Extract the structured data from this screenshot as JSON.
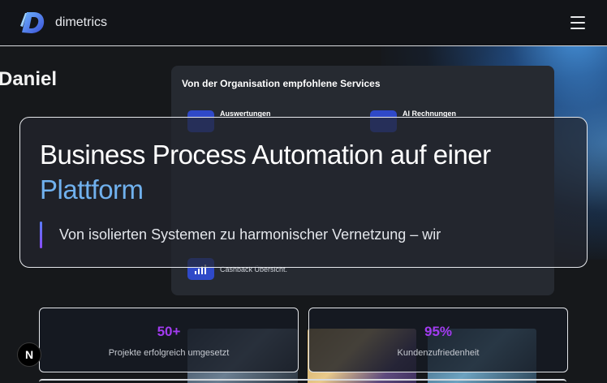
{
  "header": {
    "brand": "dimetrics",
    "logo_icon": "dimetrics-logo-icon",
    "menu_icon": "hamburger-menu-icon"
  },
  "background": {
    "name": "Daniel",
    "dashboard": {
      "title": "Von der Organisation empfohlene Services",
      "services": [
        {
          "label": "Auswertungen",
          "icon": "chart-icon"
        },
        {
          "label": "AI Rechnungen",
          "icon": "document-icon"
        },
        {
          "label": "Cashback Übersicht.",
          "icon": "bar-chart-icon"
        }
      ]
    }
  },
  "hero": {
    "title": "Business Process Automation auf einer",
    "title_accent": "Plattform",
    "subtitle": "Von isolierten Systemen zu harmonischer Vernetzung – wir"
  },
  "stats": [
    {
      "value": "50+",
      "label": "Projekte erfolgreich umgesetzt"
    },
    {
      "value": "95%",
      "label": "Kundenzufriedenheit"
    }
  ],
  "badge": {
    "label": "N",
    "icon": "nextjs-badge-icon"
  },
  "colors": {
    "accent_blue": "#70b1ee",
    "stat_purple": "#a23bf0",
    "background": "#16181b",
    "service_icon": "#2f49c8"
  }
}
